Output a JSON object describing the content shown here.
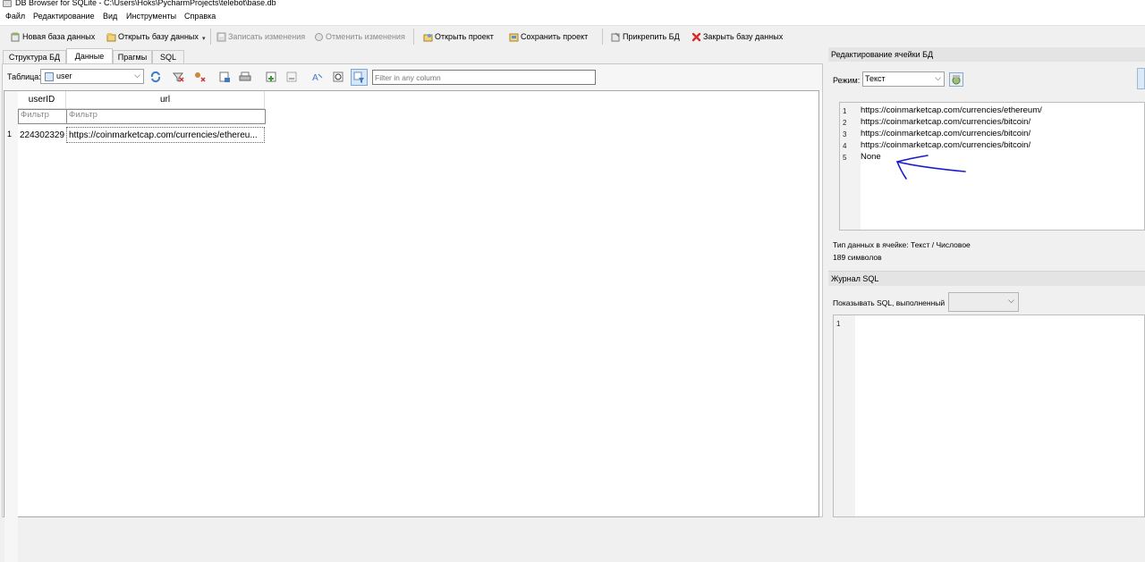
{
  "window": {
    "title": "DB Browser for SQLite - C:\\Users\\Hoks\\PycharmProjects\\telebot\\base.db"
  },
  "menu": [
    "Файл",
    "Редактирование",
    "Вид",
    "Инструменты",
    "Справка"
  ],
  "toolbar": {
    "new_db": "Новая база данных",
    "open_db": "Открыть базу данных",
    "write_changes": "Записать изменения",
    "revert_changes": "Отменить изменения",
    "open_project": "Открыть проект",
    "save_project": "Сохранить проект",
    "attach_db": "Прикрепить БД",
    "close_db": "Закрыть базу данных"
  },
  "tabs": [
    "Структура БД",
    "Данные",
    "Прагмы",
    "SQL"
  ],
  "active_tab": "Данные",
  "table_bar": {
    "label": "Таблица:",
    "selected_table": "user",
    "filter_placeholder": "Filter in any column"
  },
  "grid": {
    "columns": [
      "userID",
      "url"
    ],
    "filter_placeholder": "Фильтр",
    "rows": [
      {
        "num": "1",
        "userID": "224302329",
        "url": "https://coinmarketcap.com/currencies/ethereu..."
      }
    ]
  },
  "cell_editor": {
    "title": "Редактирование ячейки БД",
    "mode_label": "Режим:",
    "mode_value": "Текст",
    "lines": [
      {
        "n": "1",
        "text": "https://coinmarketcap.com/currencies/ethereum/"
      },
      {
        "n": "2",
        "text": "https://coinmarketcap.com/currencies/bitcoin/"
      },
      {
        "n": "3",
        "text": "https://coinmarketcap.com/currencies/bitcoin/"
      },
      {
        "n": "4",
        "text": "https://coinmarketcap.com/currencies/bitcoin/"
      },
      {
        "n": "5",
        "text": "None"
      }
    ],
    "data_type": "Тип данных в ячейке: Текст / Числовое",
    "char_count": "189 символов"
  },
  "sql_log": {
    "title": "Журнал SQL",
    "show_label": "Показывать SQL, выполненный",
    "line": "1"
  },
  "annotation_color": "#1a1acc"
}
